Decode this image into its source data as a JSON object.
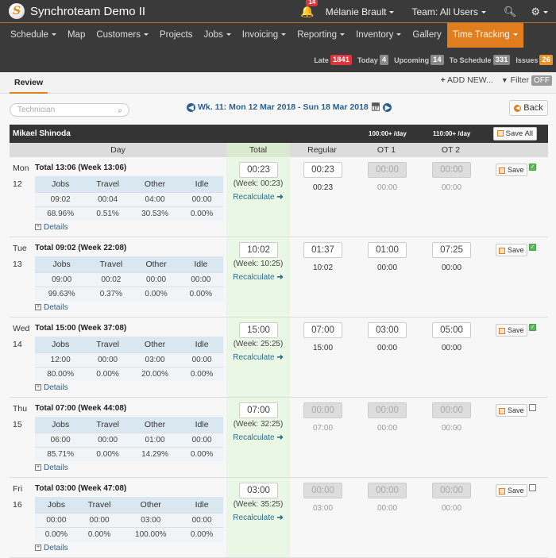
{
  "app": {
    "title": "Synchroteam Demo II",
    "logo_letter": "S"
  },
  "topbar": {
    "notifications_count": "14",
    "user": "Mélanie Brault",
    "team": "Team: All Users"
  },
  "menu": [
    {
      "label": "Schedule",
      "dropdown": true
    },
    {
      "label": "Map",
      "dropdown": false
    },
    {
      "label": "Customers",
      "dropdown": true
    },
    {
      "label": "Projects",
      "dropdown": false
    },
    {
      "label": "Jobs",
      "dropdown": true
    },
    {
      "label": "Invoicing",
      "dropdown": true
    },
    {
      "label": "Reporting",
      "dropdown": true
    },
    {
      "label": "Inventory",
      "dropdown": true
    },
    {
      "label": "Gallery",
      "dropdown": false
    },
    {
      "label": "Time Tracking",
      "dropdown": true,
      "active": true
    }
  ],
  "counters": [
    {
      "label": "Late",
      "value": "1841",
      "color": "#d9363e"
    },
    {
      "label": "Today",
      "value": "4",
      "color": "#8a8a8a"
    },
    {
      "label": "Upcoming",
      "value": "14",
      "color": "#8a8a8a"
    },
    {
      "label": "To Schedule",
      "value": "331",
      "color": "#8a8a8a"
    },
    {
      "label": "Issues",
      "value": "26",
      "color": "#e8932a"
    }
  ],
  "subbar": {
    "tab": "Review",
    "add_new": "ADD NEW...",
    "filter": "Filter",
    "filter_state": "OFF"
  },
  "toolbar": {
    "technician_placeholder": "Technician",
    "week_label": "Wk. 11: Mon 12 Mar 2018 - Sun 18 Mar 2018",
    "back": "Back"
  },
  "sheet": {
    "technician": "Mikael Shinoda",
    "ot1_rule": "100:00+ /day",
    "ot2_rule": "110:00+ /day",
    "save_all": "Save All",
    "columns": {
      "day": "Day",
      "total": "Total",
      "regular": "Regular",
      "ot1": "OT 1",
      "ot2": "OT 2"
    },
    "breakdown_headers": [
      "Jobs",
      "Travel",
      "Other",
      "Idle"
    ],
    "details_label": "Details",
    "recalculate_label": "Recalculate",
    "save_label": "Save",
    "days": [
      {
        "name": "Mon",
        "num": "12",
        "title": "Total 13:06 (Week 13:06)",
        "times": [
          "09:02",
          "00:04",
          "04:00",
          "00:00"
        ],
        "pcts": [
          "68.96%",
          "0.51%",
          "30.53%",
          "0.00%"
        ],
        "total": "00:23",
        "week": "(Week: 00:23)",
        "regular": "00:23",
        "ot1": "00:00",
        "ot2": "00:00",
        "regular_sub": "00:23",
        "ot1_sub": "00:00",
        "ot2_sub": "00:00",
        "regular_enabled": true,
        "ot_enabled": false,
        "checked": true
      },
      {
        "name": "Tue",
        "num": "13",
        "title": "Total 09:02 (Week 22:08)",
        "times": [
          "09:00",
          "00:02",
          "00:00",
          "00:00"
        ],
        "pcts": [
          "99.63%",
          "0.37%",
          "0.00%",
          "0.00%"
        ],
        "total": "10:02",
        "week": "(Week: 10:25)",
        "regular": "01:37",
        "ot1": "01:00",
        "ot2": "07:25",
        "regular_sub": "10:02",
        "ot1_sub": "00:00",
        "ot2_sub": "00:00",
        "regular_enabled": true,
        "ot_enabled": true,
        "checked": true
      },
      {
        "name": "Wed",
        "num": "14",
        "title": "Total 15:00 (Week 37:08)",
        "times": [
          "12:00",
          "00:00",
          "03:00",
          "00:00"
        ],
        "pcts": [
          "80.00%",
          "0.00%",
          "20.00%",
          "0.00%"
        ],
        "total": "15:00",
        "week": "(Week: 25:25)",
        "regular": "07:00",
        "ot1": "03:00",
        "ot2": "05:00",
        "regular_sub": "15:00",
        "ot1_sub": "00:00",
        "ot2_sub": "00:00",
        "regular_enabled": true,
        "ot_enabled": true,
        "checked": true
      },
      {
        "name": "Thu",
        "num": "15",
        "title": "Total 07:00 (Week 44:08)",
        "times": [
          "06:00",
          "00:00",
          "01:00",
          "00:00"
        ],
        "pcts": [
          "85.71%",
          "0.00%",
          "14.29%",
          "0.00%"
        ],
        "total": "07:00",
        "week": "(Week: 32:25)",
        "regular": "00:00",
        "ot1": "00:00",
        "ot2": "00:00",
        "regular_sub": "07:00",
        "ot1_sub": "00:00",
        "ot2_sub": "00:00",
        "regular_enabled": false,
        "ot_enabled": false,
        "checked": false
      },
      {
        "name": "Fri",
        "num": "16",
        "title": "Total 03:00 (Week 47:08)",
        "times": [
          "00:00",
          "00:00",
          "03:00",
          "00:00"
        ],
        "pcts": [
          "0.00%",
          "0.00%",
          "100.00%",
          "0.00%"
        ],
        "total": "03:00",
        "week": "(Week: 35:25)",
        "regular": "00:00",
        "ot1": "00:00",
        "ot2": "00:00",
        "regular_sub": "03:00",
        "ot1_sub": "00:00",
        "ot2_sub": "00:00",
        "regular_enabled": false,
        "ot_enabled": false,
        "checked": false
      }
    ]
  }
}
